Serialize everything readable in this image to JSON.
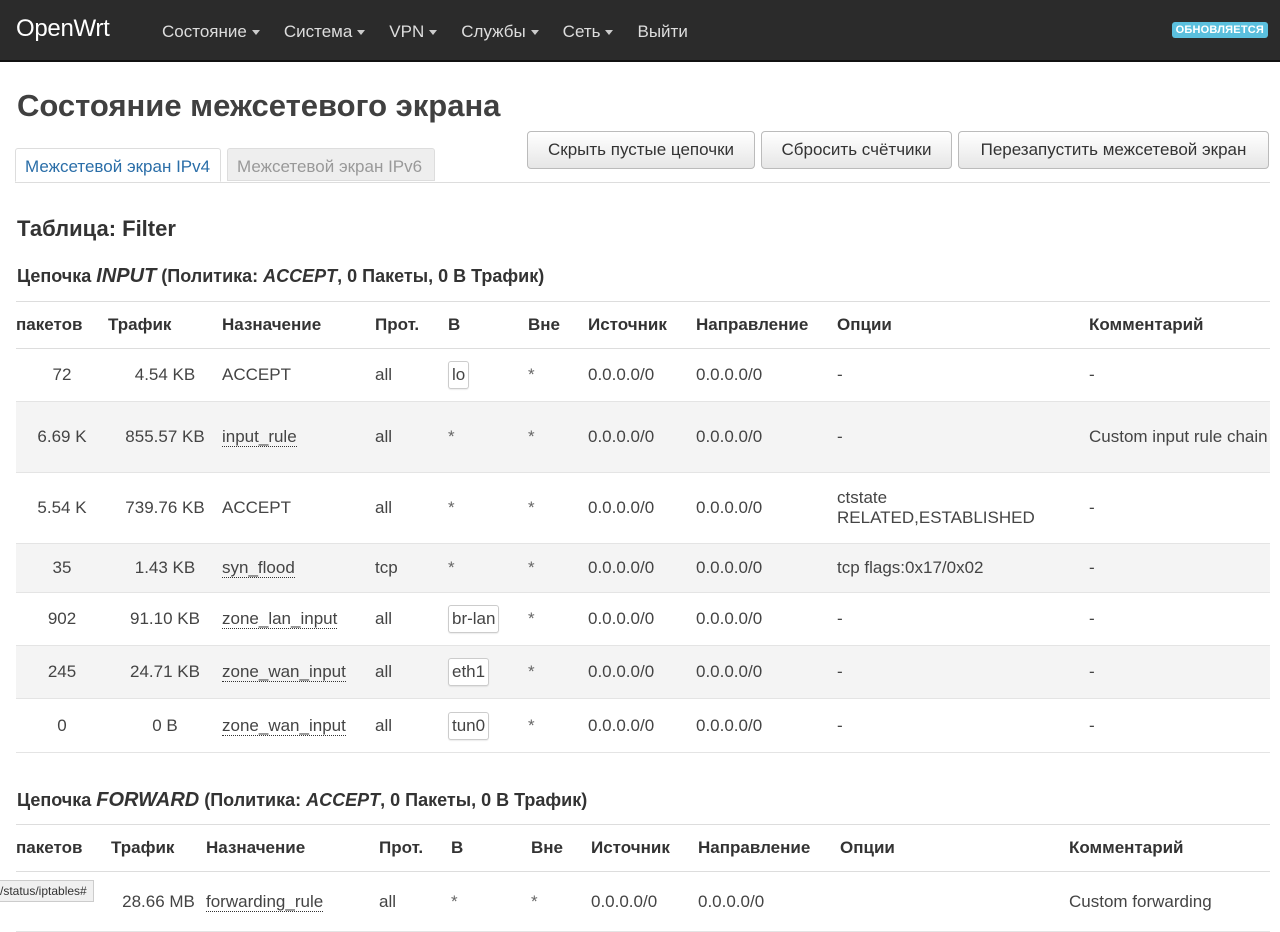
{
  "navbar": {
    "brand": "OpenWrt",
    "menu": [
      {
        "label": "Состояние",
        "dropdown": true
      },
      {
        "label": "Система",
        "dropdown": true
      },
      {
        "label": "VPN",
        "dropdown": true
      },
      {
        "label": "Службы",
        "dropdown": true
      },
      {
        "label": "Сеть",
        "dropdown": true
      },
      {
        "label": "Выйти",
        "dropdown": false
      }
    ],
    "status_badge": "ОБНОВЛЯЕТСЯ"
  },
  "page": {
    "title": "Состояние межсетевого экрана",
    "tabs": [
      "Межсетевой экран IPv4",
      "Межсетевой экран IPv6"
    ],
    "active_tab": 0,
    "buttons": [
      "Скрыть пустые цепочки",
      "Сбросить счётчики",
      "Перезапустить межсетевой экран"
    ],
    "table_title": "Таблица: Filter"
  },
  "colors": {
    "navbar_bg": "#2b2b2b",
    "badge_bg": "#5bc0de",
    "tab_active": "#2a6ea8"
  },
  "columns": [
    "пакетов",
    "Трафик",
    "Назначение",
    "Прот.",
    "В",
    "Вне",
    "Источник",
    "Направление",
    "Опции",
    "Комментарий"
  ],
  "input_chain": {
    "prefix": "Цепочка ",
    "name": "INPUT",
    "policy_label": " (Политика: ",
    "policy": "ACCEPT",
    "rest": ", 0 Пакеты, 0 В Трафик)",
    "rows": [
      {
        "packets": "72",
        "traffic": "4.54 KB",
        "target": "ACCEPT",
        "target_link": false,
        "proto": "all",
        "in": "lo",
        "in_badge": true,
        "out": "*",
        "source": "0.0.0.0/0",
        "destination": "0.0.0.0/0",
        "options": "-",
        "comment": "-"
      },
      {
        "packets": "6.69 K",
        "traffic": "855.57 KB",
        "target": "input_rule",
        "target_link": true,
        "proto": "all",
        "in": "*",
        "in_badge": false,
        "out": "*",
        "source": "0.0.0.0/0",
        "destination": "0.0.0.0/0",
        "options": "-",
        "comment": "Custom input rule chain"
      },
      {
        "packets": "5.54 K",
        "traffic": "739.76 KB",
        "target": "ACCEPT",
        "target_link": false,
        "proto": "all",
        "in": "*",
        "in_badge": false,
        "out": "*",
        "source": "0.0.0.0/0",
        "destination": "0.0.0.0/0",
        "options": "ctstate RELATED,ESTABLISHED",
        "comment": "-"
      },
      {
        "packets": "35",
        "traffic": "1.43 KB",
        "target": "syn_flood",
        "target_link": true,
        "proto": "tcp",
        "in": "*",
        "in_badge": false,
        "out": "*",
        "source": "0.0.0.0/0",
        "destination": "0.0.0.0/0",
        "options": "tcp flags:0x17/0x02",
        "comment": "-"
      },
      {
        "packets": "902",
        "traffic": "91.10 KB",
        "target": "zone_lan_input",
        "target_link": true,
        "proto": "all",
        "in": "br-lan",
        "in_badge": true,
        "out": "*",
        "source": "0.0.0.0/0",
        "destination": "0.0.0.0/0",
        "options": "-",
        "comment": "-"
      },
      {
        "packets": "245",
        "traffic": "24.71 KB",
        "target": "zone_wan_input",
        "target_link": true,
        "proto": "all",
        "in": "eth1",
        "in_badge": true,
        "out": "*",
        "source": "0.0.0.0/0",
        "destination": "0.0.0.0/0",
        "options": "-",
        "comment": "-"
      },
      {
        "packets": "0",
        "traffic": "0 B",
        "target": "zone_wan_input",
        "target_link": true,
        "proto": "all",
        "in": "tun0",
        "in_badge": true,
        "out": "*",
        "source": "0.0.0.0/0",
        "destination": "0.0.0.0/0",
        "options": "-",
        "comment": "-"
      }
    ]
  },
  "forward_chain": {
    "prefix": "Цепочка ",
    "name": "FORWARD",
    "policy_label": " (Политика: ",
    "policy": "ACCEPT",
    "rest": ", 0 Пакеты, 0 В Трафик)",
    "rows": [
      {
        "packets": "",
        "traffic": "28.66 MB",
        "target": "forwarding_rule",
        "target_link": true,
        "proto": "all",
        "in": "*",
        "in_badge": false,
        "out": "*",
        "source": "0.0.0.0/0",
        "destination": "0.0.0.0/0",
        "options": "",
        "comment": "Custom forwarding"
      }
    ]
  },
  "statusbar_url": "/status/iptables#"
}
